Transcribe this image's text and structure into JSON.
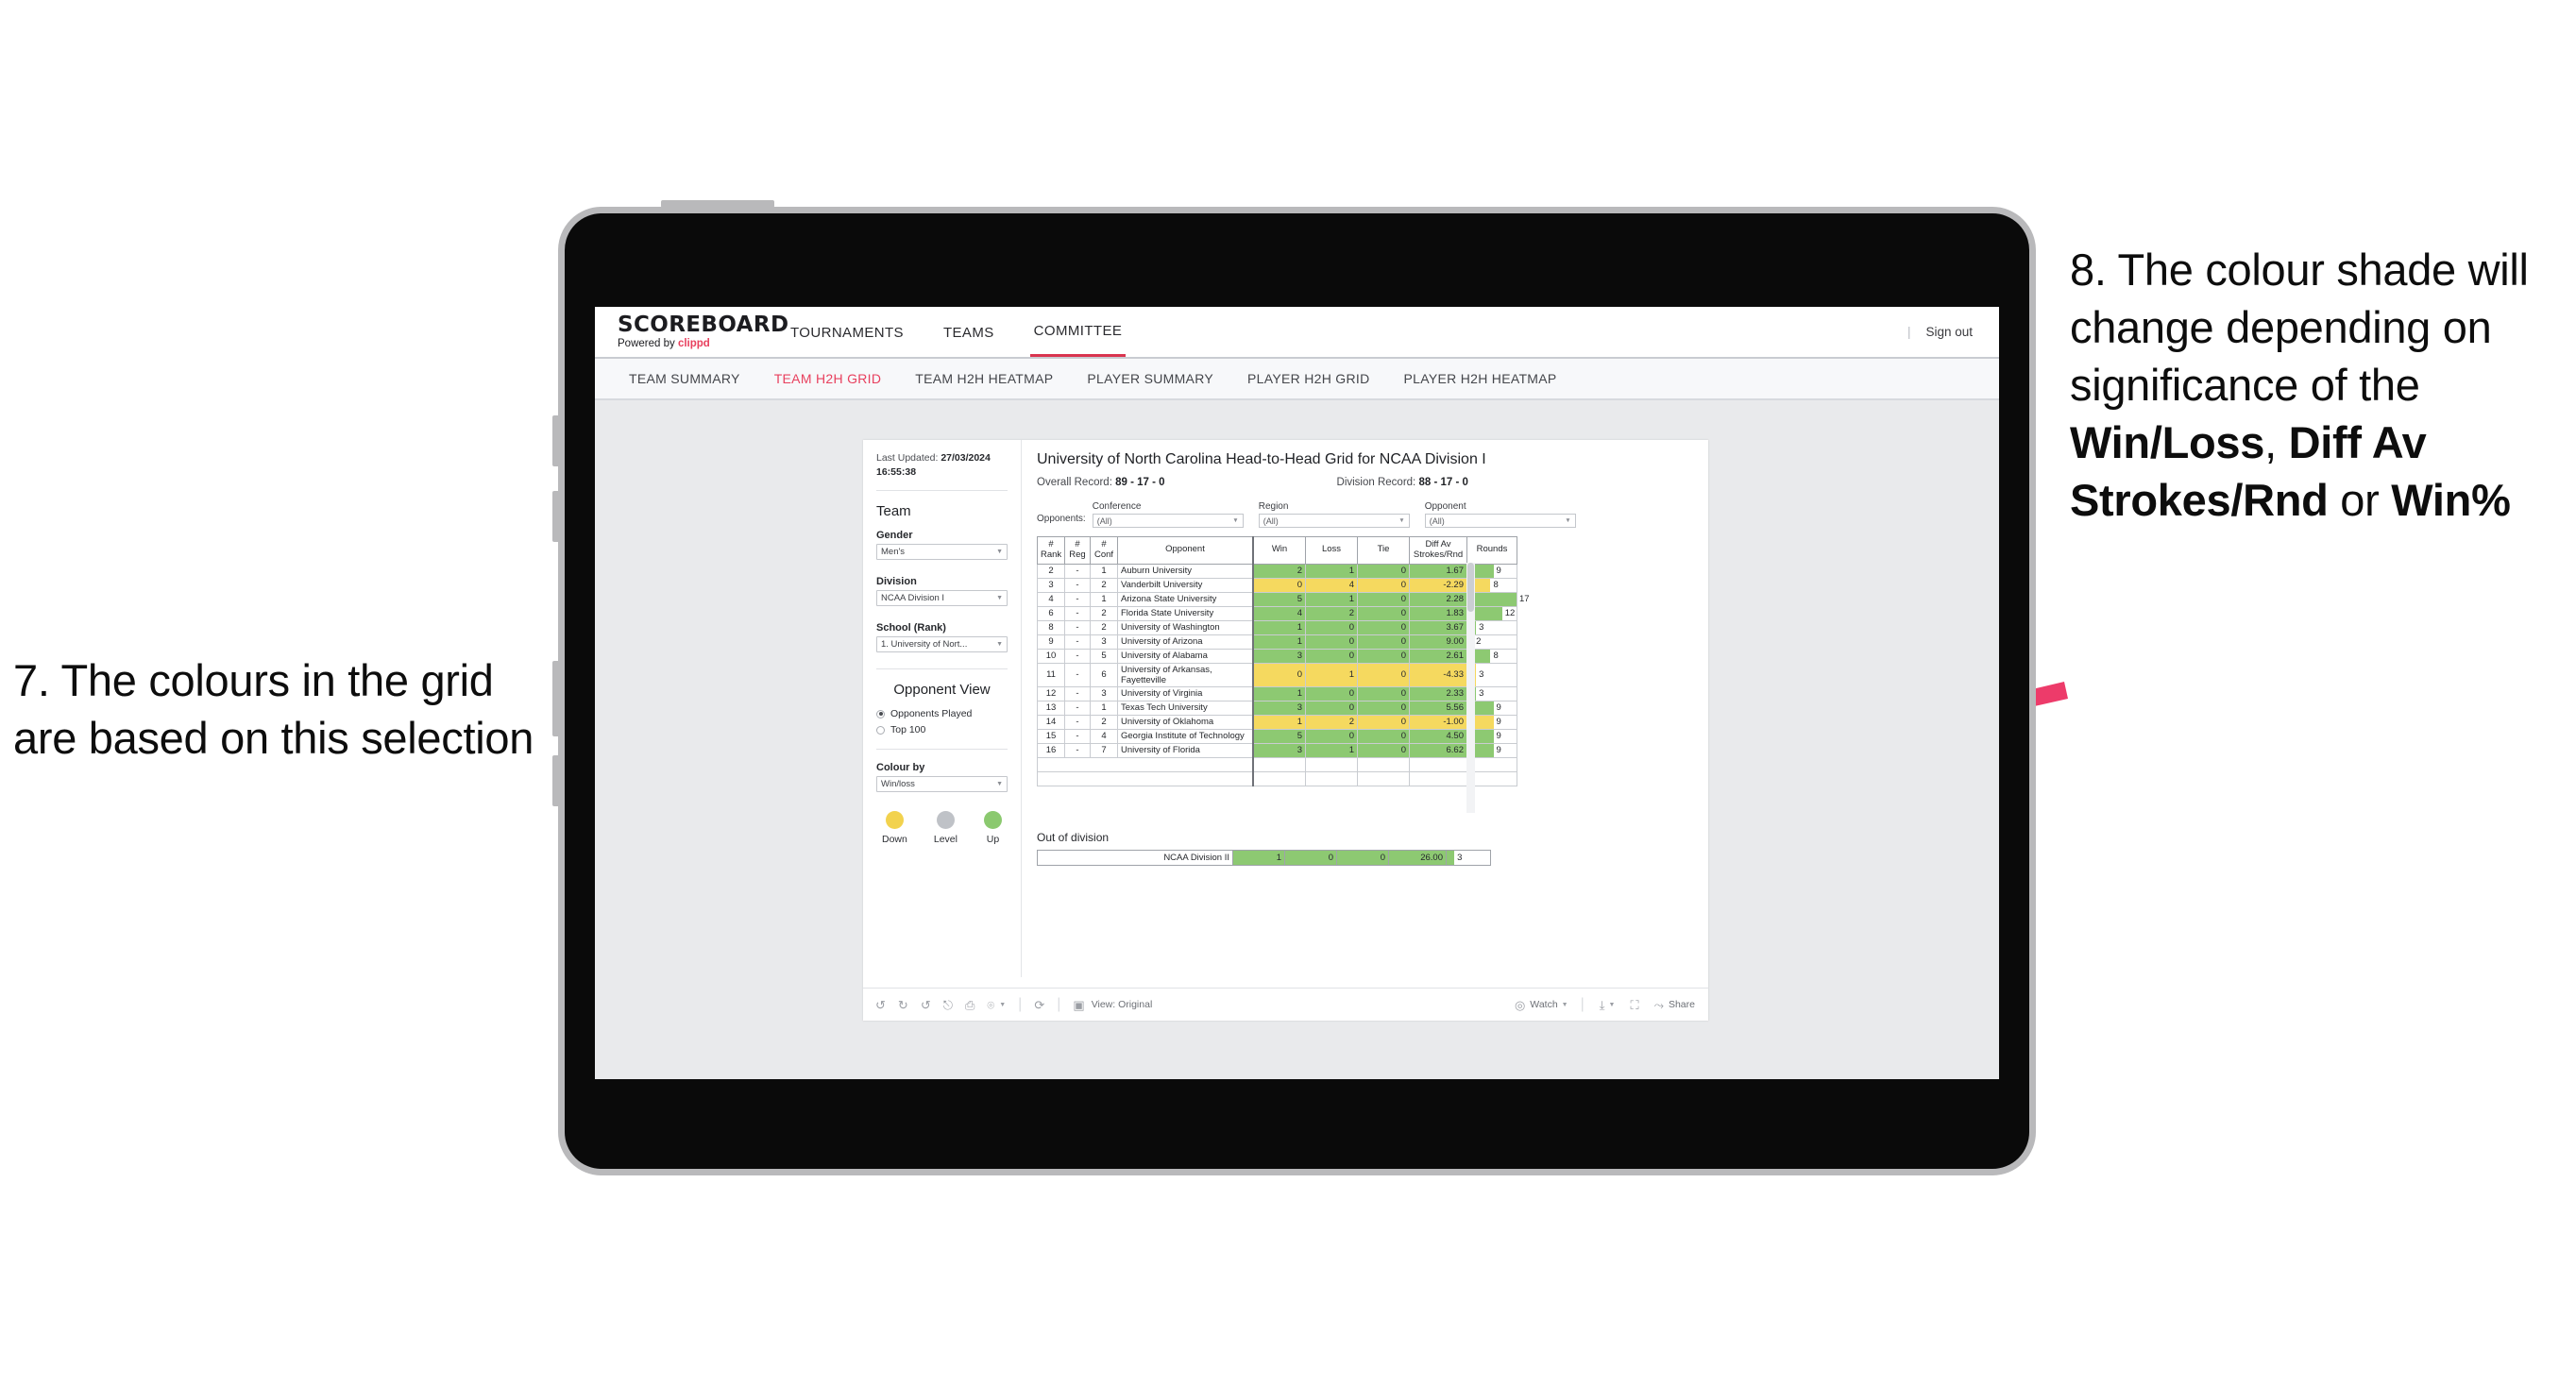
{
  "annotations": {
    "left": "7. The colours in the grid are based on this selection",
    "right_pre": "8. The colour shade will change depending on significance of the ",
    "right_bold1": "Win/Loss",
    "right_mid1": ", ",
    "right_bold2": "Diff Av Strokes/Rnd",
    "right_mid2": " or ",
    "right_bold3": "Win%",
    "arrow_color": "#ed3b6a"
  },
  "topnav": {
    "brand_title": "SCOREBOARD",
    "brand_sub_pre": "Powered by ",
    "brand_sub_accent": "clippd",
    "items": [
      {
        "label": "TOURNAMENTS",
        "active": false
      },
      {
        "label": "TEAMS",
        "active": false
      },
      {
        "label": "COMMITTEE",
        "active": true
      }
    ],
    "sign_out": "Sign out",
    "accent": "#d9344f"
  },
  "subnav": {
    "items": [
      {
        "label": "TEAM SUMMARY",
        "active": false
      },
      {
        "label": "TEAM H2H GRID",
        "active": true
      },
      {
        "label": "TEAM H2H HEATMAP",
        "active": false
      },
      {
        "label": "PLAYER SUMMARY",
        "active": false
      },
      {
        "label": "PLAYER H2H GRID",
        "active": false
      },
      {
        "label": "PLAYER H2H HEATMAP",
        "active": false
      }
    ]
  },
  "sidebar": {
    "last_updated_label": "Last Updated:",
    "last_updated_date": "27/03/2024",
    "last_updated_time": "16:55:38",
    "team_heading": "Team",
    "gender_label": "Gender",
    "gender_value": "Men's",
    "division_label": "Division",
    "division_value": "NCAA Division I",
    "school_label": "School (Rank)",
    "school_value": "1. University of Nort...",
    "opponent_view_heading": "Opponent View",
    "radio_options": [
      {
        "label": "Opponents Played",
        "selected": true
      },
      {
        "label": "Top 100",
        "selected": false
      }
    ],
    "colour_by_label": "Colour by",
    "colour_by_value": "Win/loss",
    "legend": [
      {
        "label": "Down",
        "color": "#f2d24e"
      },
      {
        "label": "Level",
        "color": "#bfc2c7"
      },
      {
        "label": "Up",
        "color": "#8bc96f"
      }
    ]
  },
  "main": {
    "title": "University of North Carolina Head-to-Head Grid for NCAA Division I",
    "overall_label": "Overall Record:",
    "overall_value": "89 - 17 - 0",
    "division_label": "Division Record:",
    "division_value": "88 - 17 - 0",
    "opponents_label": "Opponents:",
    "filters": [
      {
        "label": "Conference",
        "value": "(All)"
      },
      {
        "label": "Region",
        "value": "(All)"
      },
      {
        "label": "Opponent",
        "value": "(All)"
      }
    ],
    "out_of_division_label": "Out of division"
  },
  "chart_data": {
    "type": "table",
    "title": "University of North Carolina Head-to-Head Grid for NCAA Division I",
    "columns": [
      "# Rank",
      "# Reg",
      "# Conf",
      "Opponent",
      "Win",
      "Loss",
      "Tie",
      "Diff Av Strokes/Rnd",
      "Rounds"
    ],
    "column_header_lines": [
      [
        "#",
        "Rank"
      ],
      [
        "#",
        "Reg"
      ],
      [
        "#",
        "Conf"
      ],
      [
        "Opponent"
      ],
      [
        "Win"
      ],
      [
        "Loss"
      ],
      [
        "Tie"
      ],
      [
        "Diff Av",
        "Strokes/Rnd"
      ],
      [
        "Rounds"
      ]
    ],
    "rounds_max": 17,
    "colour_by": "Win/loss",
    "colours": {
      "up": "#8dc972",
      "down": "#f5d95f",
      "level": "#bfc2c7"
    },
    "rows": [
      {
        "rank": "2",
        "reg": "-",
        "conf": "1",
        "opponent": "Auburn University",
        "win": "2",
        "loss": "1",
        "tie": "0",
        "diff": "1.67",
        "rounds": "9",
        "state": "up"
      },
      {
        "rank": "3",
        "reg": "-",
        "conf": "2",
        "opponent": "Vanderbilt University",
        "win": "0",
        "loss": "4",
        "tie": "0",
        "diff": "-2.29",
        "rounds": "8",
        "state": "down"
      },
      {
        "rank": "4",
        "reg": "-",
        "conf": "1",
        "opponent": "Arizona State University",
        "win": "5",
        "loss": "1",
        "tie": "0",
        "diff": "2.28",
        "rounds": "17",
        "state": "up"
      },
      {
        "rank": "6",
        "reg": "-",
        "conf": "2",
        "opponent": "Florida State University",
        "win": "4",
        "loss": "2",
        "tie": "0",
        "diff": "1.83",
        "rounds": "12",
        "state": "up"
      },
      {
        "rank": "8",
        "reg": "-",
        "conf": "2",
        "opponent": "University of Washington",
        "win": "1",
        "loss": "0",
        "tie": "0",
        "diff": "3.67",
        "rounds": "3",
        "state": "up"
      },
      {
        "rank": "9",
        "reg": "-",
        "conf": "3",
        "opponent": "University of Arizona",
        "win": "1",
        "loss": "0",
        "tie": "0",
        "diff": "9.00",
        "rounds": "2",
        "state": "up"
      },
      {
        "rank": "10",
        "reg": "-",
        "conf": "5",
        "opponent": "University of Alabama",
        "win": "3",
        "loss": "0",
        "tie": "0",
        "diff": "2.61",
        "rounds": "8",
        "state": "up"
      },
      {
        "rank": "11",
        "reg": "-",
        "conf": "6",
        "opponent": "University of Arkansas, Fayetteville",
        "win": "0",
        "loss": "1",
        "tie": "0",
        "diff": "-4.33",
        "rounds": "3",
        "state": "down"
      },
      {
        "rank": "12",
        "reg": "-",
        "conf": "3",
        "opponent": "University of Virginia",
        "win": "1",
        "loss": "0",
        "tie": "0",
        "diff": "2.33",
        "rounds": "3",
        "state": "up"
      },
      {
        "rank": "13",
        "reg": "-",
        "conf": "1",
        "opponent": "Texas Tech University",
        "win": "3",
        "loss": "0",
        "tie": "0",
        "diff": "5.56",
        "rounds": "9",
        "state": "up"
      },
      {
        "rank": "14",
        "reg": "-",
        "conf": "2",
        "opponent": "University of Oklahoma",
        "win": "1",
        "loss": "2",
        "tie": "0",
        "diff": "-1.00",
        "rounds": "9",
        "state": "down"
      },
      {
        "rank": "15",
        "reg": "-",
        "conf": "4",
        "opponent": "Georgia Institute of Technology",
        "win": "5",
        "loss": "0",
        "tie": "0",
        "diff": "4.50",
        "rounds": "9",
        "state": "up"
      },
      {
        "rank": "16",
        "reg": "-",
        "conf": "7",
        "opponent": "University of Florida",
        "win": "3",
        "loss": "1",
        "tie": "0",
        "diff": "6.62",
        "rounds": "9",
        "state": "up"
      }
    ],
    "out_of_division": [
      {
        "name": "NCAA Division II",
        "win": "1",
        "loss": "0",
        "tie": "0",
        "diff": "26.00",
        "rounds": "3",
        "state": "up"
      }
    ]
  },
  "toolbar": {
    "view_label": "View: Original",
    "watch_label": "Watch",
    "share_label": "Share"
  }
}
